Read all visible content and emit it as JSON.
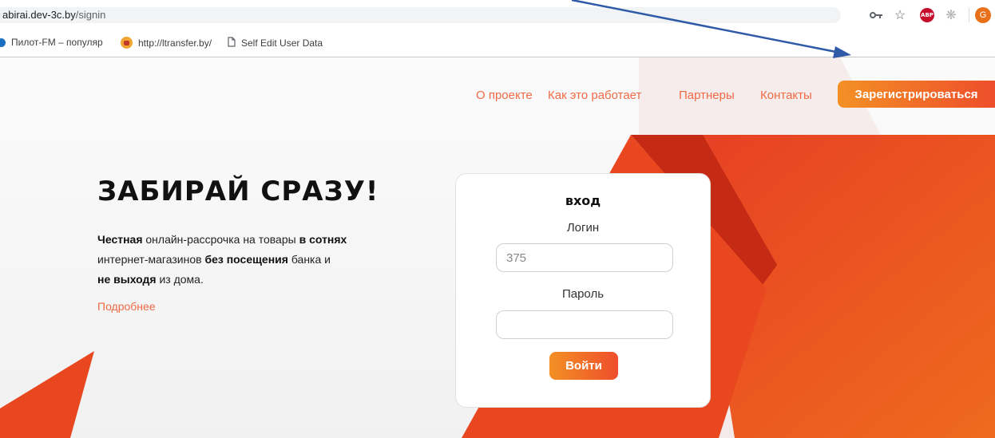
{
  "browser": {
    "url_host": "abirai.dev-3c.by",
    "url_path": "/signin",
    "profile_initial": "G",
    "adblock_label": "ABP",
    "bookmarks": [
      {
        "label": "Пилот-FM – популяр",
        "icon": "radio-icon"
      },
      {
        "label": "http://ltransfer.by/",
        "icon": "site-favicon"
      },
      {
        "label": "Self Edit User Data",
        "icon": "page-icon"
      }
    ]
  },
  "nav": {
    "items": [
      "О проекте",
      "Как это работает",
      "Партнеры",
      "Контакты"
    ],
    "register_label": "Зарегистрироваться"
  },
  "hero": {
    "title": "ЗАБИРАЙ СРАЗУ!",
    "line1_bold1": "Честная",
    "line1_text": " онлайн-рассрочка на товары ",
    "line1_bold2": "в сотнях",
    "line2_text": "интернет-магазинов ",
    "line2_bold": "без посещения",
    "line2_text2": " банка и",
    "line3_bold": "не выходя",
    "line3_text": " из дома.",
    "more_link": "Подробнее"
  },
  "login": {
    "title": "вход",
    "login_label": "Логин",
    "login_placeholder": "375",
    "password_label": "Пароль",
    "password_placeholder": "",
    "submit_label": "Войти"
  },
  "colors": {
    "accent": "#f06a45",
    "button_gradient_start": "#f39025",
    "button_gradient_end": "#ee4e2b",
    "annotation_arrow": "#2e5aa8"
  }
}
